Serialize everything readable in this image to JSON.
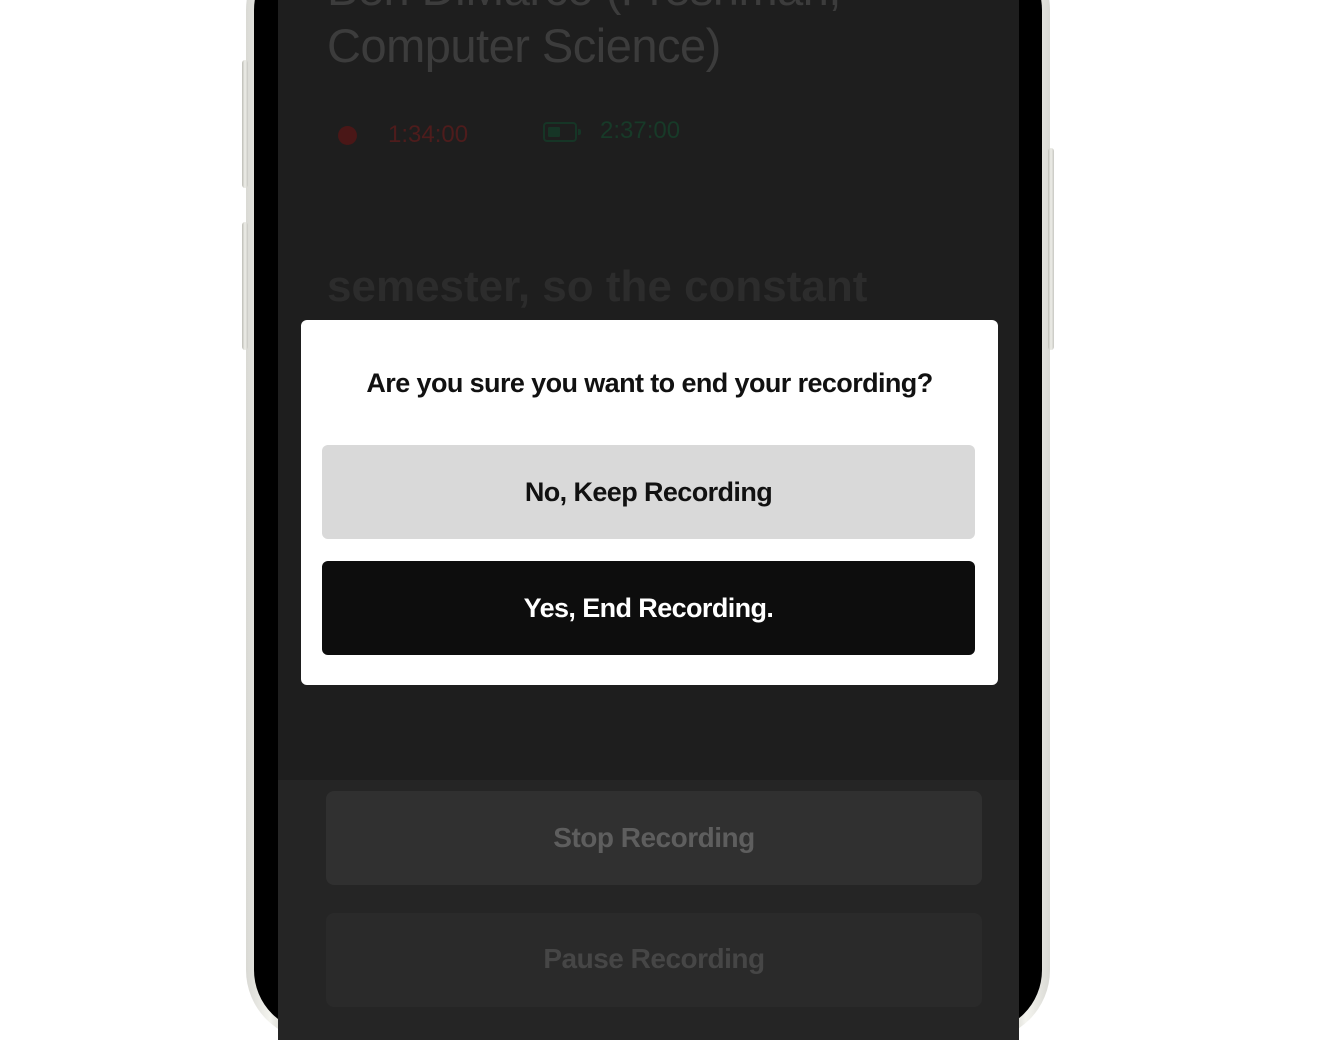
{
  "background": {
    "title": "Ben DiMarco (Freshman,\nComputer Science)",
    "recording_time": "1:34:00",
    "battery_time": "2:37:00",
    "transcript_snippet": "semester, so the constant",
    "stop_button": "Stop Recording",
    "pause_button": "Pause Recording"
  },
  "dialog": {
    "title": "Are you sure you want to end your recording?",
    "keep_button": "No, Keep Recording",
    "end_button": "Yes, End Recording."
  },
  "colors": {
    "dialog_background": "#ffffff",
    "keep_button_bg": "#d9d9d9",
    "end_button_bg": "#0d0d0d",
    "recording_indicator": "#4a1717",
    "battery_indicator": "#163526"
  },
  "icons": [
    "recording-dot-icon",
    "battery-icon"
  ]
}
